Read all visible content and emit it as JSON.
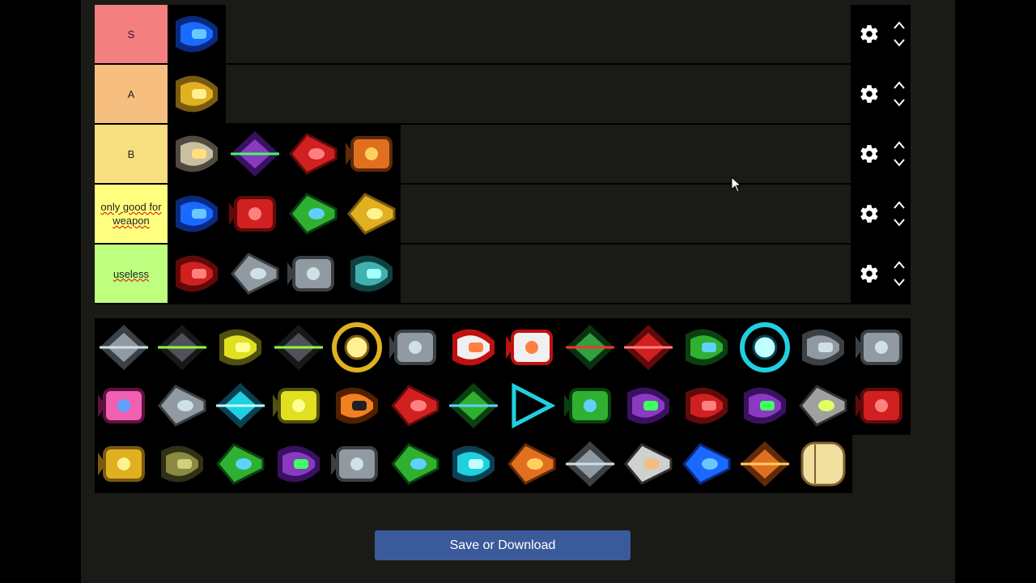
{
  "tiers": [
    {
      "label": "S",
      "color": "#f47f7f",
      "ships": [
        "blue-orb-ship"
      ]
    },
    {
      "label": "A",
      "color": "#f7bf7f",
      "ships": [
        "gold-ship"
      ]
    },
    {
      "label": "B",
      "color": "#f7df7f",
      "ships": [
        "bone-ship",
        "purple-fin-ship",
        "red-mech-ship",
        "orange-crab-ship"
      ]
    },
    {
      "label": "only good for weapon",
      "color": "#ffff7f",
      "ships": [
        "blue-armor-ship",
        "red-hook-ship",
        "green-cyan-ship",
        "gold-insect-ship"
      ]
    },
    {
      "label": "useless",
      "color": "#bfff7f",
      "ships": [
        "red-rocket-ship",
        "grey-dome-ship",
        "grey-block-ship",
        "teal-arrow-ship"
      ]
    }
  ],
  "pool": [
    [
      "pink-grey-ship",
      "dark-jet-ship",
      "yellow-claw-ship",
      "dark-bat-ship",
      "gold-ring-ship",
      "grey-mech-ship",
      "rocket-ship",
      "rocket-flame",
      "medic-ship",
      "red-fortress-ship",
      "green-tank-ship",
      "cyan-ring-ship",
      "grey-dome-ship-2",
      "grey-dome-ship-3"
    ],
    [
      "pink-fighter",
      "grey-wing-ship",
      "cyan-crab-ship",
      "yellow-barrel-ship",
      "pumpkin-ship",
      "red-white-ship",
      "green-bug-ship",
      "cyan-triangle",
      "green-mech-ship",
      "purple-claw-ship",
      "red-bug-ship",
      "purple-dart-ship",
      "skull-ship",
      "red-wing-ship"
    ],
    [
      "gold-cross-ship",
      "olive-tank-ship",
      "green-dome-ship",
      "purple-spark-ship",
      "grey-jet-ship",
      "green-claw-ship",
      "cyan-fork-ship",
      "orange-fork-ship",
      "grey-dome-ship-4",
      "spider-ship",
      "blue-diamond-ship",
      "orange-pod-ship",
      "cream-capsule"
    ]
  ],
  "save_button": {
    "label": "Save or Download"
  }
}
